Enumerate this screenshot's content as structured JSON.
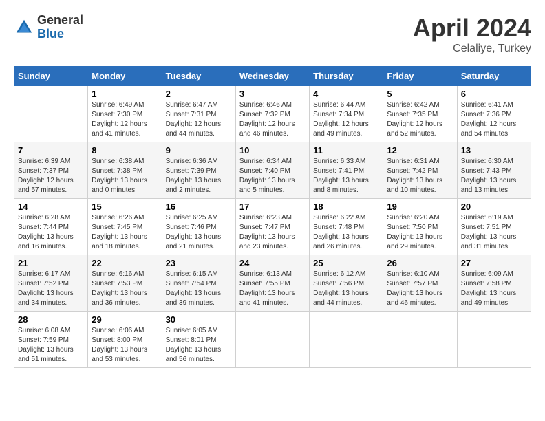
{
  "header": {
    "logo_general": "General",
    "logo_blue": "Blue",
    "title": "April 2024",
    "location": "Celaliye, Turkey"
  },
  "days_of_week": [
    "Sunday",
    "Monday",
    "Tuesday",
    "Wednesday",
    "Thursday",
    "Friday",
    "Saturday"
  ],
  "weeks": [
    [
      {
        "day": "",
        "info": ""
      },
      {
        "day": "1",
        "info": "Sunrise: 6:49 AM\nSunset: 7:30 PM\nDaylight: 12 hours\nand 41 minutes."
      },
      {
        "day": "2",
        "info": "Sunrise: 6:47 AM\nSunset: 7:31 PM\nDaylight: 12 hours\nand 44 minutes."
      },
      {
        "day": "3",
        "info": "Sunrise: 6:46 AM\nSunset: 7:32 PM\nDaylight: 12 hours\nand 46 minutes."
      },
      {
        "day": "4",
        "info": "Sunrise: 6:44 AM\nSunset: 7:34 PM\nDaylight: 12 hours\nand 49 minutes."
      },
      {
        "day": "5",
        "info": "Sunrise: 6:42 AM\nSunset: 7:35 PM\nDaylight: 12 hours\nand 52 minutes."
      },
      {
        "day": "6",
        "info": "Sunrise: 6:41 AM\nSunset: 7:36 PM\nDaylight: 12 hours\nand 54 minutes."
      }
    ],
    [
      {
        "day": "7",
        "info": "Sunrise: 6:39 AM\nSunset: 7:37 PM\nDaylight: 12 hours\nand 57 minutes."
      },
      {
        "day": "8",
        "info": "Sunrise: 6:38 AM\nSunset: 7:38 PM\nDaylight: 13 hours\nand 0 minutes."
      },
      {
        "day": "9",
        "info": "Sunrise: 6:36 AM\nSunset: 7:39 PM\nDaylight: 13 hours\nand 2 minutes."
      },
      {
        "day": "10",
        "info": "Sunrise: 6:34 AM\nSunset: 7:40 PM\nDaylight: 13 hours\nand 5 minutes."
      },
      {
        "day": "11",
        "info": "Sunrise: 6:33 AM\nSunset: 7:41 PM\nDaylight: 13 hours\nand 8 minutes."
      },
      {
        "day": "12",
        "info": "Sunrise: 6:31 AM\nSunset: 7:42 PM\nDaylight: 13 hours\nand 10 minutes."
      },
      {
        "day": "13",
        "info": "Sunrise: 6:30 AM\nSunset: 7:43 PM\nDaylight: 13 hours\nand 13 minutes."
      }
    ],
    [
      {
        "day": "14",
        "info": "Sunrise: 6:28 AM\nSunset: 7:44 PM\nDaylight: 13 hours\nand 16 minutes."
      },
      {
        "day": "15",
        "info": "Sunrise: 6:26 AM\nSunset: 7:45 PM\nDaylight: 13 hours\nand 18 minutes."
      },
      {
        "day": "16",
        "info": "Sunrise: 6:25 AM\nSunset: 7:46 PM\nDaylight: 13 hours\nand 21 minutes."
      },
      {
        "day": "17",
        "info": "Sunrise: 6:23 AM\nSunset: 7:47 PM\nDaylight: 13 hours\nand 23 minutes."
      },
      {
        "day": "18",
        "info": "Sunrise: 6:22 AM\nSunset: 7:48 PM\nDaylight: 13 hours\nand 26 minutes."
      },
      {
        "day": "19",
        "info": "Sunrise: 6:20 AM\nSunset: 7:50 PM\nDaylight: 13 hours\nand 29 minutes."
      },
      {
        "day": "20",
        "info": "Sunrise: 6:19 AM\nSunset: 7:51 PM\nDaylight: 13 hours\nand 31 minutes."
      }
    ],
    [
      {
        "day": "21",
        "info": "Sunrise: 6:17 AM\nSunset: 7:52 PM\nDaylight: 13 hours\nand 34 minutes."
      },
      {
        "day": "22",
        "info": "Sunrise: 6:16 AM\nSunset: 7:53 PM\nDaylight: 13 hours\nand 36 minutes."
      },
      {
        "day": "23",
        "info": "Sunrise: 6:15 AM\nSunset: 7:54 PM\nDaylight: 13 hours\nand 39 minutes."
      },
      {
        "day": "24",
        "info": "Sunrise: 6:13 AM\nSunset: 7:55 PM\nDaylight: 13 hours\nand 41 minutes."
      },
      {
        "day": "25",
        "info": "Sunrise: 6:12 AM\nSunset: 7:56 PM\nDaylight: 13 hours\nand 44 minutes."
      },
      {
        "day": "26",
        "info": "Sunrise: 6:10 AM\nSunset: 7:57 PM\nDaylight: 13 hours\nand 46 minutes."
      },
      {
        "day": "27",
        "info": "Sunrise: 6:09 AM\nSunset: 7:58 PM\nDaylight: 13 hours\nand 49 minutes."
      }
    ],
    [
      {
        "day": "28",
        "info": "Sunrise: 6:08 AM\nSunset: 7:59 PM\nDaylight: 13 hours\nand 51 minutes."
      },
      {
        "day": "29",
        "info": "Sunrise: 6:06 AM\nSunset: 8:00 PM\nDaylight: 13 hours\nand 53 minutes."
      },
      {
        "day": "30",
        "info": "Sunrise: 6:05 AM\nSunset: 8:01 PM\nDaylight: 13 hours\nand 56 minutes."
      },
      {
        "day": "",
        "info": ""
      },
      {
        "day": "",
        "info": ""
      },
      {
        "day": "",
        "info": ""
      },
      {
        "day": "",
        "info": ""
      }
    ]
  ]
}
